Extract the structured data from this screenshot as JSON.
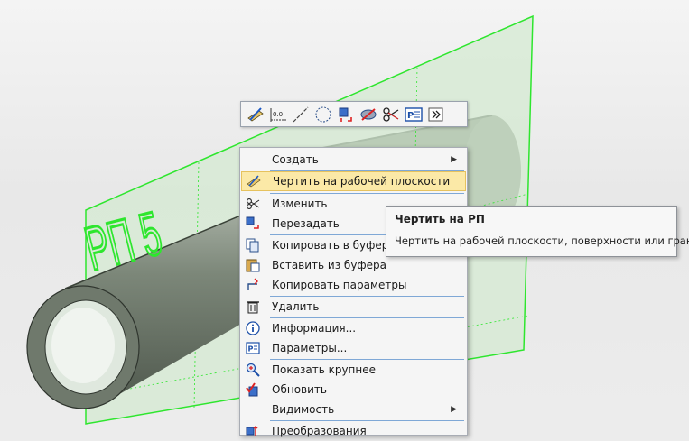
{
  "plane_label": "РП 5",
  "mini_toolbar": {
    "buttons": [
      {
        "icon": "sketch-on-plane-icon"
      },
      {
        "icon": "dimension-icon"
      },
      {
        "icon": "line-icon"
      },
      {
        "icon": "circle-icon"
      },
      {
        "icon": "transform-icon"
      },
      {
        "icon": "visibility-icon"
      },
      {
        "icon": "scissors-icon"
      },
      {
        "icon": "parameters-icon"
      },
      {
        "icon": "expand-icon"
      }
    ],
    "dimension_text": "0.0"
  },
  "context_menu": {
    "items": [
      {
        "label": "Создать",
        "has_submenu": true,
        "icon": ""
      },
      {
        "label": "Чертить на рабочей плоскости",
        "has_submenu": false,
        "icon": "sketch-on-plane-icon",
        "highlighted": true
      },
      {
        "label": "Изменить",
        "has_submenu": false,
        "icon": "edit-icon"
      },
      {
        "label": "Перезадать",
        "has_submenu": false,
        "icon": "redefine-icon"
      },
      {
        "label": "Копировать в буфер",
        "has_submenu": false,
        "icon": "copy-icon"
      },
      {
        "label": "Вставить из буфера",
        "has_submenu": false,
        "icon": "paste-icon"
      },
      {
        "label": "Копировать параметры",
        "has_submenu": false,
        "icon": "copy-params-icon"
      },
      {
        "label": "Удалить",
        "has_submenu": false,
        "icon": "delete-icon"
      },
      {
        "label": "Информация...",
        "has_submenu": false,
        "icon": "info-icon"
      },
      {
        "label": "Параметры...",
        "has_submenu": false,
        "icon": "parameters-icon"
      },
      {
        "label": "Показать крупнее",
        "has_submenu": false,
        "icon": "zoom-icon"
      },
      {
        "label": "Обновить",
        "has_submenu": false,
        "icon": "refresh-icon"
      },
      {
        "label": "Видимость",
        "has_submenu": true,
        "icon": ""
      },
      {
        "label": "Преобразования",
        "has_submenu": false,
        "icon": "transform-icon"
      }
    ]
  },
  "tooltip": {
    "title": "Чертить на РП",
    "text": "Чертить на рабочей плоскости, поверхности или грани"
  },
  "colors": {
    "plane_edge": "#2ee62e",
    "plane_fill": "#cfe8cf",
    "cylinder": "#6f7a6c",
    "menu_highlight": "#fbe9a7",
    "separator": "#7fa8d6"
  }
}
